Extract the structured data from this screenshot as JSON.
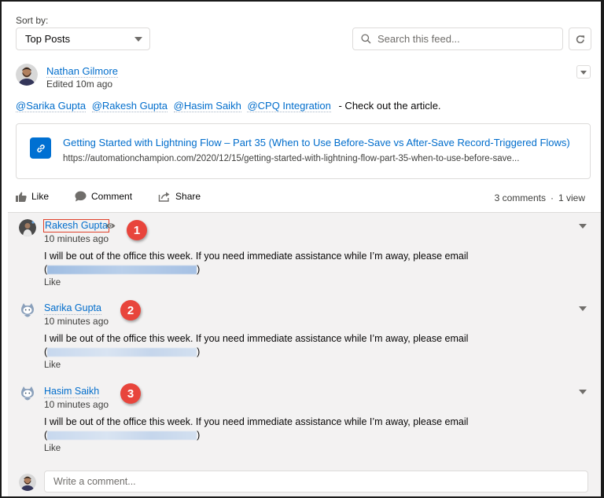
{
  "toolbar": {
    "sort_label": "Sort by:",
    "sort_value": "Top Posts",
    "search_placeholder": "Search this feed...",
    "refresh_icon": "refresh-icon"
  },
  "post": {
    "author": "Nathan Gilmore",
    "edited": "Edited 10m ago",
    "mentions": [
      "@Sarika Gupta",
      "@Rakesh Gupta",
      "@Hasim Saikh",
      "@CPQ Integration"
    ],
    "text": "- Check out the article.",
    "link": {
      "icon": "link-icon",
      "title": "Getting Started with Lightning Flow – Part 35 (When to Use Before-Save vs After-Save Record-Triggered Flows)",
      "url": "https://automationchampion.com/2020/12/15/getting-started-with-lightning-flow-part-35-when-to-use-before-save..."
    },
    "actions": {
      "like": "Like",
      "comment": "Comment",
      "share": "Share"
    },
    "stats": {
      "comments": "3 comments",
      "separator": "·",
      "views": "1 view"
    }
  },
  "comments": [
    {
      "author": "Rakesh Gupta",
      "time": "10 minutes ago",
      "text": "I will be out of the office this week. If you need immediate assistance while I’m away, please email",
      "email_obscured": "rakesh@automationchampion.com",
      "like": "Like",
      "badge": "1"
    },
    {
      "author": "Sarika Gupta",
      "time": "10 minutes ago",
      "text": "I will be out of the office this week. If you need immediate assistance while I’m away, please email",
      "like": "Like",
      "badge": "2"
    },
    {
      "author": "Hasim Saikh",
      "time": "10 minutes ago",
      "text": "I will be out of the office this week. If you need immediate assistance while I’m away, please email",
      "like": "Like",
      "badge": "3"
    }
  ],
  "composer": {
    "placeholder": "Write a comment..."
  },
  "colors": {
    "link": "#006dcc",
    "badge": "#e8453c",
    "link_icon_bg": "#0070d2",
    "highlight_border": "#e0412b",
    "comments_bg": "#f3f2f2"
  }
}
